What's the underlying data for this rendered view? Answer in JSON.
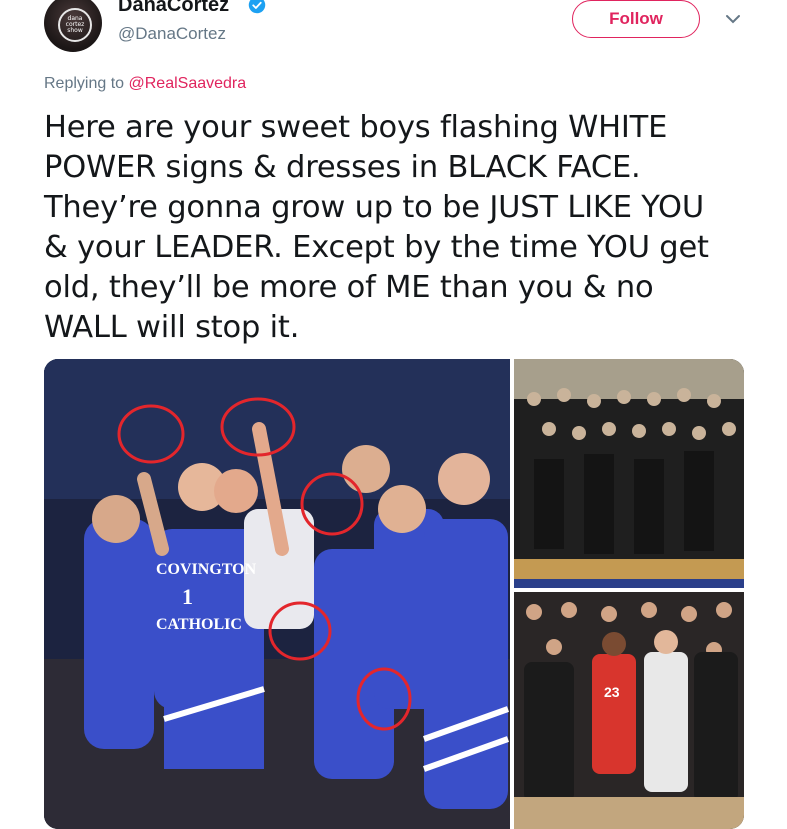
{
  "header": {
    "display_name": "DanaCortez",
    "handle": "@DanaCortez",
    "follow_label": "Follow",
    "avatar_text": "dana cortez show"
  },
  "reply": {
    "prefix": "Replying to ",
    "mention": "@RealSaavedra"
  },
  "tweet": {
    "text": "Here are your sweet boys flashing WHITE\nPOWER signs & dresses in BLACK FACE.\nThey’re gonna grow up to be JUST LIKE YOU\n& your LEADER. Except by the time YOU get\nold, they’ll be more of ME than you & no\nWALL will stop it."
  },
  "media": {
    "main_jersey_text": [
      "COVINGTON",
      "1",
      "CATHOLIC"
    ],
    "bottom_jersey_text": [
      "23"
    ]
  },
  "colors": {
    "accent": "#e0245e",
    "verified": "#1da1f2",
    "secondary_text": "#657786",
    "jersey_blue": "#3a4fc9"
  }
}
